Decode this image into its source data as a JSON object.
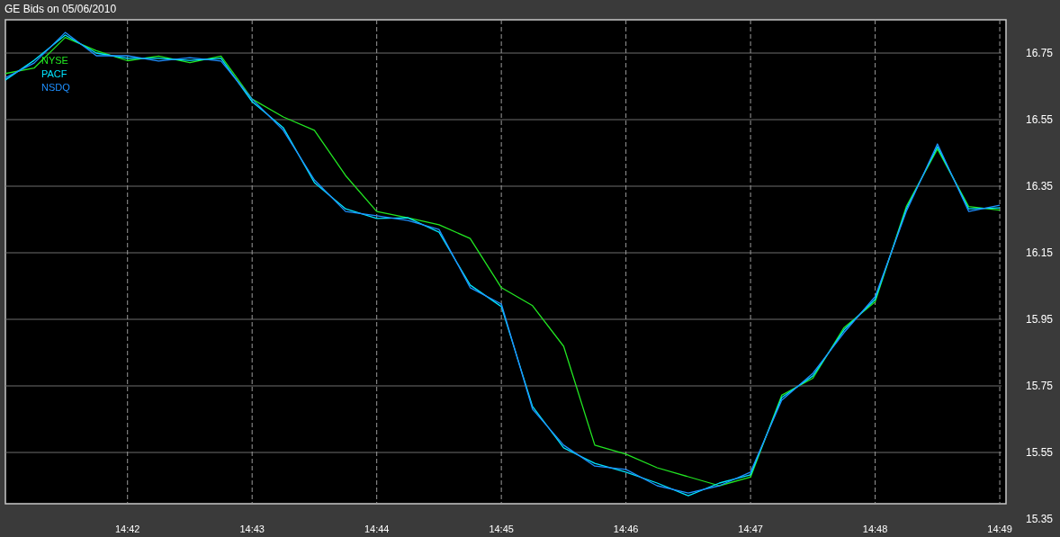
{
  "window": {
    "title": "GE Bids on 05/06/2010"
  },
  "chart": {
    "chart_data": {
      "type": "line",
      "grid": true,
      "ylim": [
        15.35,
        16.85
      ],
      "categories": [
        null,
        null,
        null,
        null,
        "14:42",
        null,
        null,
        null,
        "14:43",
        null,
        null,
        null,
        "14:44",
        null,
        null,
        null,
        "14:45",
        null,
        null,
        null,
        "14:46",
        null,
        null,
        null,
        "14:47",
        null,
        null,
        null,
        "14:48",
        null,
        null,
        null,
        "14:49"
      ],
      "yticks": [
        {
          "value": 16.75,
          "label": "16.75"
        },
        {
          "value": 16.55,
          "label": "16.55"
        },
        {
          "value": 16.35,
          "label": "16.35"
        },
        {
          "value": 16.15,
          "label": "16.15"
        },
        {
          "value": 15.95,
          "label": "15.95"
        },
        {
          "value": 15.75,
          "label": "15.75"
        },
        {
          "value": 15.55,
          "label": "15.55"
        },
        {
          "value": 15.35,
          "label": "15.35"
        }
      ],
      "series": [
        {
          "name": "NYSE",
          "color": "#22e622",
          "values": [
            16.687,
            16.705,
            16.797,
            16.757,
            16.727,
            16.741,
            16.721,
            16.741,
            16.612,
            16.558,
            16.518,
            16.382,
            16.274,
            16.255,
            16.234,
            16.193,
            16.045,
            15.991,
            15.869,
            15.572,
            15.545,
            15.504,
            15.477,
            15.45,
            15.476,
            15.722,
            15.773,
            15.925,
            16.003,
            16.289,
            16.462,
            16.289,
            16.278
          ]
        },
        {
          "name": "PACF",
          "color": "#00e5ff",
          "values": [
            16.664,
            16.728,
            16.804,
            16.75,
            16.734,
            16.734,
            16.728,
            16.734,
            16.604,
            16.526,
            16.361,
            16.282,
            16.253,
            16.255,
            16.212,
            16.053,
            15.988,
            15.688,
            15.564,
            15.517,
            15.491,
            15.458,
            15.42,
            15.458,
            15.483,
            15.715,
            15.78,
            15.918,
            16.01,
            16.282,
            16.469,
            16.282,
            16.285
          ]
        },
        {
          "name": "NSDQ",
          "color": "#1e90ff",
          "values": [
            16.672,
            16.72,
            16.812,
            16.742,
            16.742,
            16.726,
            16.736,
            16.726,
            16.612,
            16.518,
            16.369,
            16.274,
            16.261,
            16.247,
            16.22,
            16.045,
            15.996,
            15.68,
            15.572,
            15.509,
            15.499,
            15.45,
            15.428,
            15.45,
            15.491,
            15.707,
            15.788,
            15.91,
            16.018,
            16.274,
            16.477,
            16.274,
            16.293
          ]
        }
      ]
    }
  }
}
